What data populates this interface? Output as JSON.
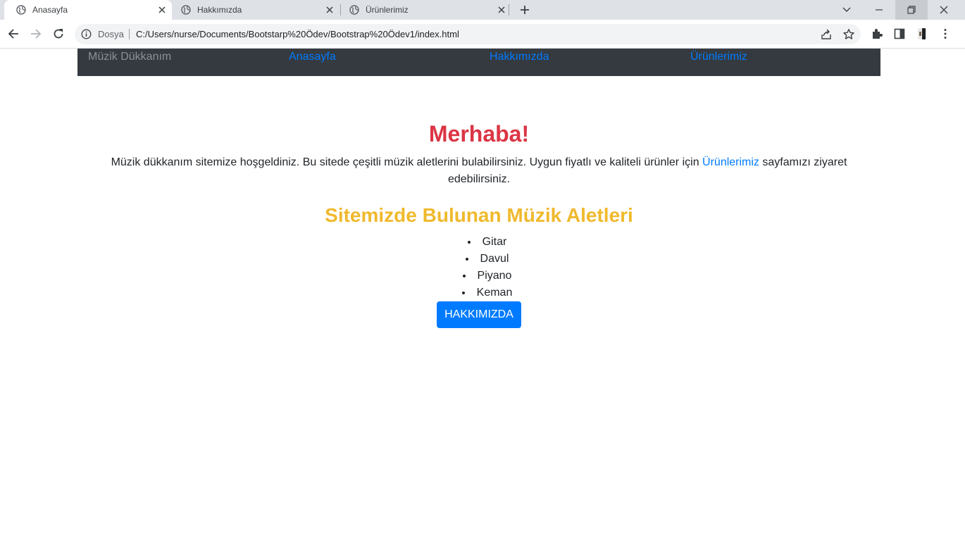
{
  "browser": {
    "tabs": [
      {
        "title": "Anasayfa",
        "icon": "globe-icon",
        "active": true
      },
      {
        "title": "Hakkımızda",
        "icon": "globe-icon",
        "active": false
      },
      {
        "title": "Ürünlerimiz",
        "icon": "globe-icon",
        "active": false
      }
    ],
    "address": {
      "security_label": "Dosya",
      "url": "C:/Users/nurse/Documents/Bootstarp%20Ödev/Bootstrap%20Ödev1/index.html"
    }
  },
  "page": {
    "navbar": {
      "brand": "Müzik Dükkanım",
      "links": [
        "Anasayfa",
        "Hakkımızda",
        "Ürünlerimiz"
      ]
    },
    "hero": {
      "title": "Merhaba!",
      "intro_before": "Müzik dükkanım sitemize hoşgeldiniz. Bu sitede çeşitli müzik aletlerini bulabilirsiniz. Uygun fiyatlı ve kaliteli ürünler için ",
      "intro_link": "Ürünlerimiz",
      "intro_after": " sayfamızı ziyaret edebilirsiniz."
    },
    "instruments": {
      "title": "Sitemizde Bulunan Müzik Aletleri",
      "items": [
        "Gitar",
        "Davul",
        "Piyano",
        "Keman"
      ]
    },
    "button_label": "HAKKIMIZDA"
  },
  "colors": {
    "title_red": "#dc3545",
    "subtitle_yellow": "#f0b92d",
    "link_blue": "#007bff",
    "navbar_dark": "#343a40"
  }
}
